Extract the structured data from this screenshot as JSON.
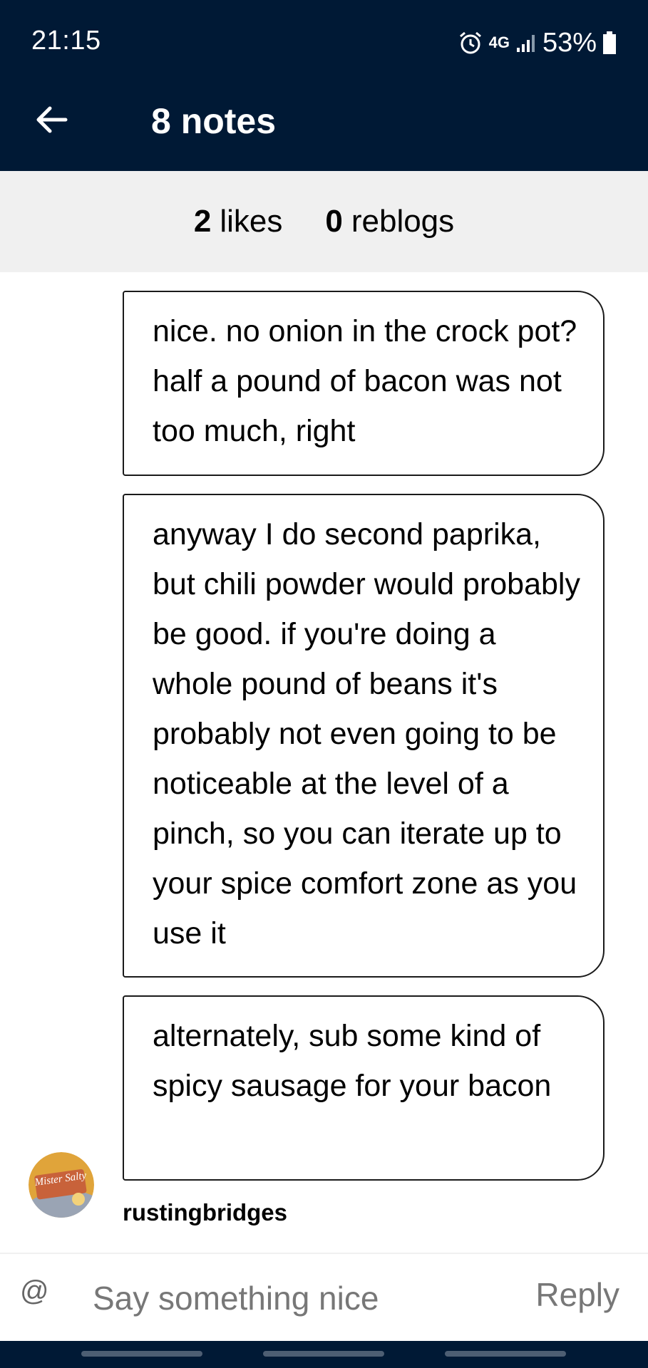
{
  "status_bar": {
    "time": "21:15",
    "network": "4G",
    "battery": "53%",
    "icons": [
      "alarm-icon",
      "network-4g-icon",
      "signal-icon",
      "battery-icon"
    ]
  },
  "header": {
    "back_icon": "arrow-left-icon",
    "title": "8 notes"
  },
  "summary": {
    "likes_count": "2",
    "likes_label": "likes",
    "reblogs_count": "0",
    "reblogs_label": "reblogs"
  },
  "messages": [
    {
      "text": "nice. no onion in the crock pot? half a pound of bacon was not too much, right"
    },
    {
      "text": "anyway I do second paprika, but chili powder would probably be good. if you're doing a whole pound of beans it's probably not even going to be noticeable at the level of a pinch, so you can iterate up to your spice comfort zone as you use it"
    },
    {
      "text": "alternately, sub some kind of spicy sausage for your bacon"
    }
  ],
  "author": {
    "username": "rustingbridges",
    "avatar_text": "Mister Salty"
  },
  "reply_bar": {
    "at_symbol": "@",
    "input_value": "",
    "placeholder": "Say something nice",
    "reply_label": "Reply"
  },
  "colors": {
    "header_bg": "#001935",
    "summary_bg": "#f0f0f0",
    "placeholder": "#777777"
  }
}
